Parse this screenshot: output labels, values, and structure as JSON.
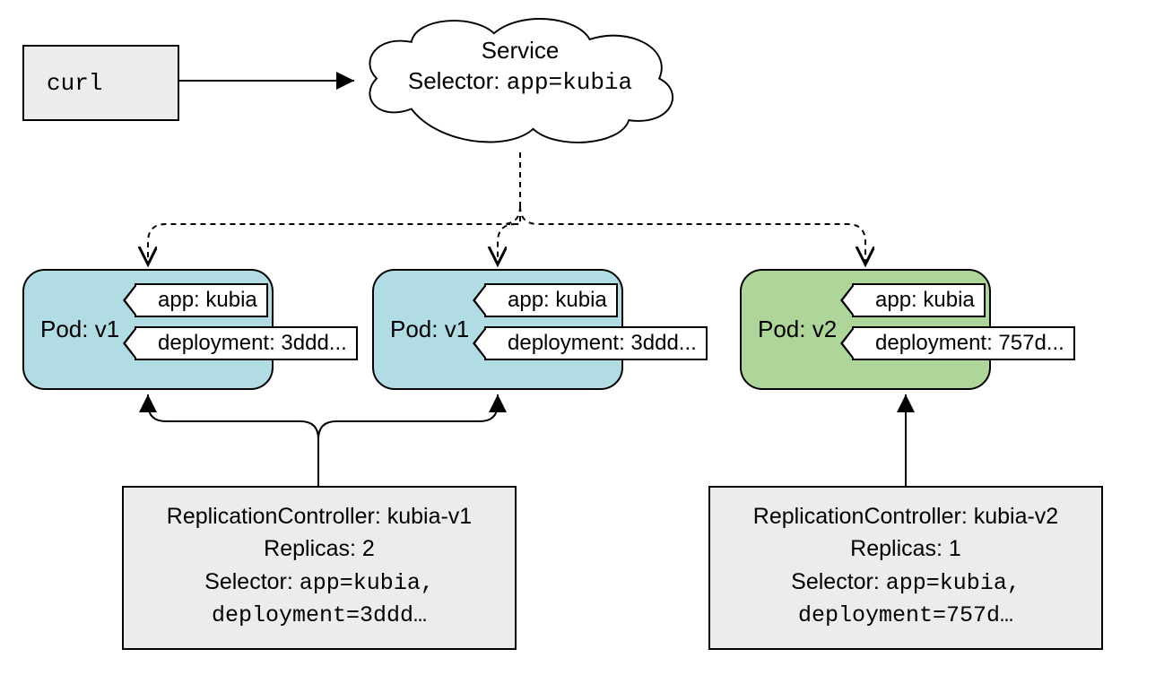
{
  "curl": {
    "label": "curl"
  },
  "service": {
    "title": "Service",
    "selector_label": "Selector:",
    "selector_value": "app=kubia"
  },
  "pods": [
    {
      "id": "v1a",
      "title": "Pod: v1",
      "label_app": "app: kubia",
      "label_deploy": "deployment: 3ddd..."
    },
    {
      "id": "v1b",
      "title": "Pod: v1",
      "label_app": "app: kubia",
      "label_deploy": "deployment: 3ddd..."
    },
    {
      "id": "v2",
      "title": "Pod: v2",
      "label_app": "app: kubia",
      "label_deploy": "deployment: 757d..."
    }
  ],
  "rcs": [
    {
      "id": "v1",
      "title": "ReplicationController: kubia-v1",
      "replicas_label": "Replicas: 2",
      "selector_label": "Selector:",
      "selector_value1": "app=kubia,",
      "selector_value2": "deployment=3ddd…"
    },
    {
      "id": "v2",
      "title": "ReplicationController: kubia-v2",
      "replicas_label": "Replicas: 1",
      "selector_label": "Selector:",
      "selector_value1": "app=kubia,",
      "selector_value2": "deployment=757d…"
    }
  ]
}
